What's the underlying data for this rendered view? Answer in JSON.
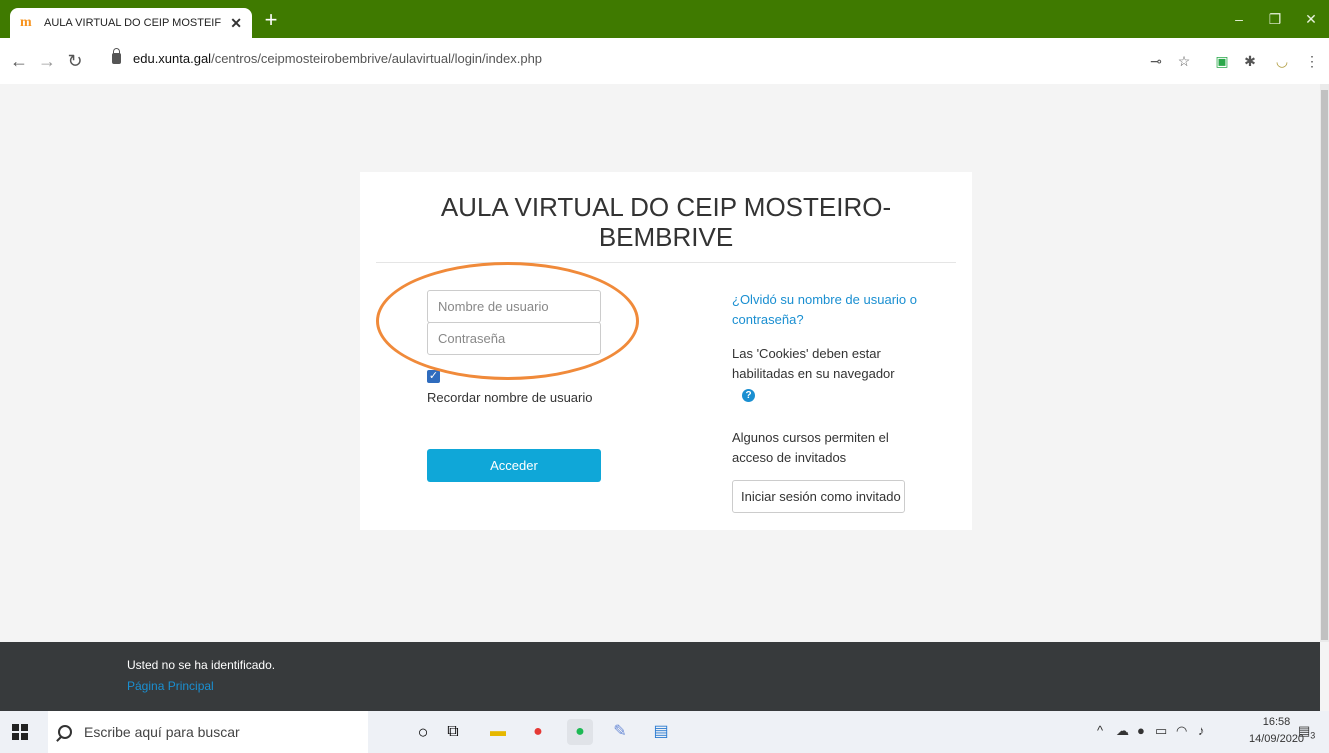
{
  "browser": {
    "tab_title": "AULA VIRTUAL DO CEIP MOSTEIF",
    "tab_close": "✕",
    "new_tab": "+",
    "url_domain": "edu.xunta.gal",
    "url_path": "/centros/ceipmosteirobembrive/aulavirtual/login/index.php",
    "window_controls": [
      "–",
      "❐",
      "✕"
    ]
  },
  "login": {
    "title": "AULA VIRTUAL DO CEIP MOSTEIRO-BEMBRIVE",
    "username_placeholder": "Nombre de usuario",
    "password_placeholder": "Contraseña",
    "remember_checked": true,
    "remember_label": "Recordar nombre de usuario",
    "submit_label": "Acceder",
    "forgot_link": "¿Olvidó su nombre de usuario o contraseña?",
    "cookies_notice": "Las 'Cookies' deben estar habilitadas en su navegador",
    "guest_notice": "Algunos cursos permiten el acceso de invitados",
    "guest_button": "Iniciar sesión como invitado"
  },
  "footer": {
    "not_logged": "Usted no se ha identificado.",
    "home_link": "Página Principal"
  },
  "taskbar": {
    "search_placeholder": "Escribe aquí para buscar",
    "time": "16:58",
    "date": "14/09/2020",
    "notification_count": "3"
  },
  "colors": {
    "chrome_green": "#3f7a00",
    "accent_blue": "#0fa7d8",
    "link_blue": "#1a8fd1",
    "annotation_orange": "#f08a3a",
    "footer_dark": "#373a3c"
  }
}
